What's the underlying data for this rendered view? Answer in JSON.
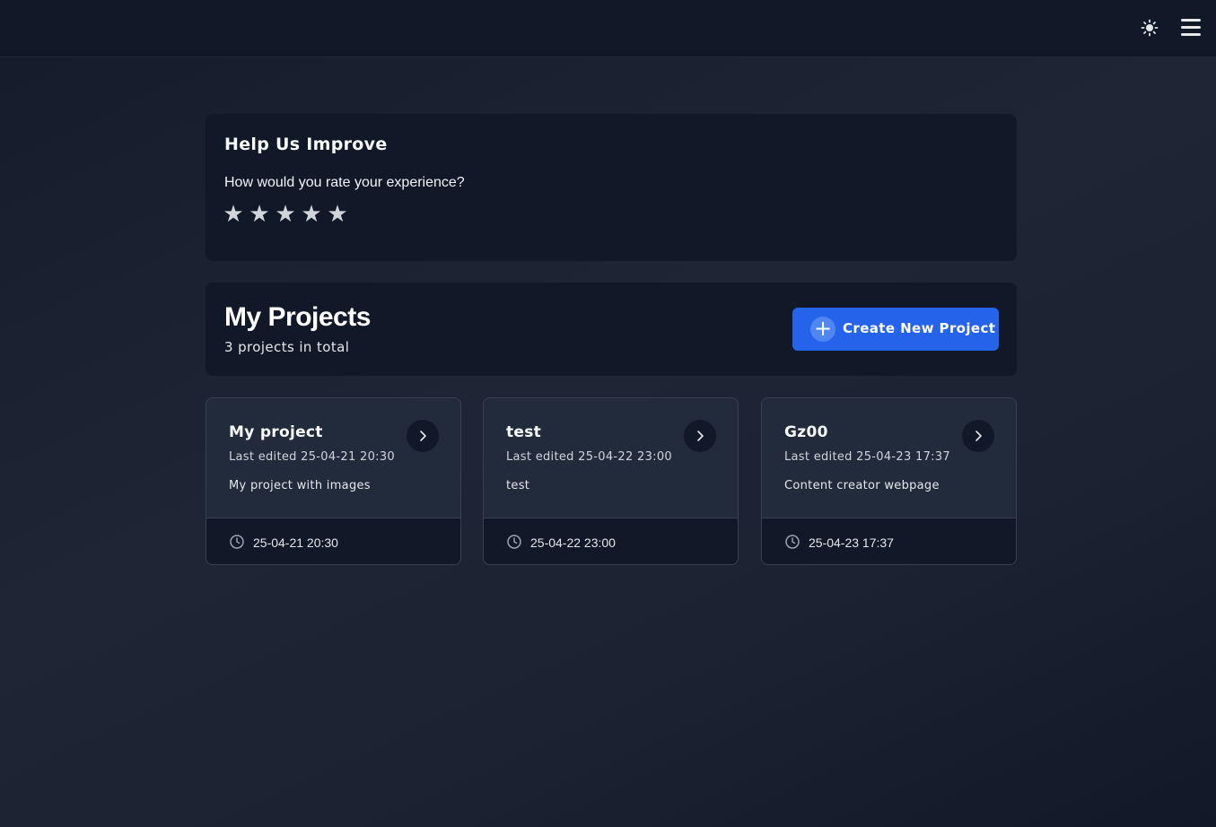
{
  "header": {
    "theme_icon": "sun-icon",
    "menu_icon": "hamburger-menu-icon"
  },
  "feedback": {
    "title": "Help Us Improve",
    "question": "How would you rate your experience?",
    "stars": [
      "★",
      "★",
      "★",
      "★",
      "★"
    ],
    "rating": 0,
    "max_rating": 5
  },
  "projects": {
    "title": "My Projects",
    "count_text": "3 projects in total",
    "create_button": {
      "label": "Create New Project",
      "icon": "plus-icon",
      "color": "#2563eb"
    },
    "items": [
      {
        "title": "My project",
        "last_edited": "Last edited 25-04-21 20:30",
        "description": "My project with images",
        "date": "25-04-21 20:30"
      },
      {
        "title": "test",
        "last_edited": "Last edited 25-04-22 23:00",
        "description": "test",
        "date": "25-04-22 23:00"
      },
      {
        "title": "Gz00",
        "last_edited": "Last edited 25-04-23 17:37",
        "description": "Content creator webpage",
        "date": "25-04-23 17:37"
      }
    ]
  }
}
